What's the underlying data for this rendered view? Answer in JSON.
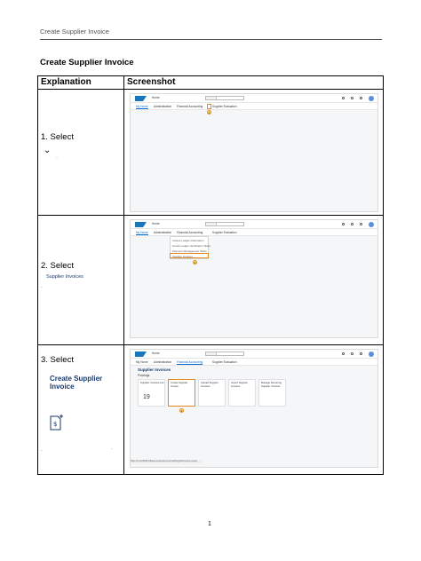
{
  "header": {
    "running_title": "Create Supplier Invoice",
    "title": "Create Supplier Invoice"
  },
  "table": {
    "col_explanation": "Explanation",
    "col_screenshot": "Screenshot"
  },
  "steps": [
    {
      "label": "1. Select",
      "sub": "⌄"
    },
    {
      "label": "2. Select",
      "sub": "Supplier Invoices"
    },
    {
      "label": "3. Select",
      "sub": "Create Supplier Invoice"
    }
  ],
  "app": {
    "home_label": "Home",
    "tabs": [
      "My Home",
      "Administration",
      "Financial Accounting",
      "Supplier Evaluation"
    ],
    "menu_items": [
      "Invoice Lodger Information",
      "Goods Ledger Verification Tasks",
      "Payment Management Tasks",
      "Supplier Invoices"
    ],
    "group_title": "Supplier Invoices",
    "group_sub": "Postings",
    "tiles": [
      {
        "label": "Supplier Invoices List",
        "value": "19"
      },
      {
        "label": "Create Supplier Invoice",
        "value": ""
      },
      {
        "label": "Upload Supplier Invoices",
        "value": ""
      },
      {
        "label": "Import Supplier Invoices",
        "value": ""
      },
      {
        "label": "Manage Recurring Supplier Invoices",
        "value": ""
      }
    ],
    "status_url": "https://my123456.s4hana.ondemand.com/ui#SupplierInvoice-create"
  },
  "colors": {
    "accent": "#e8891b",
    "sap_blue": "#1b75bb",
    "title_navy": "#1a3a6e"
  },
  "footer": {
    "page_number": "1"
  }
}
